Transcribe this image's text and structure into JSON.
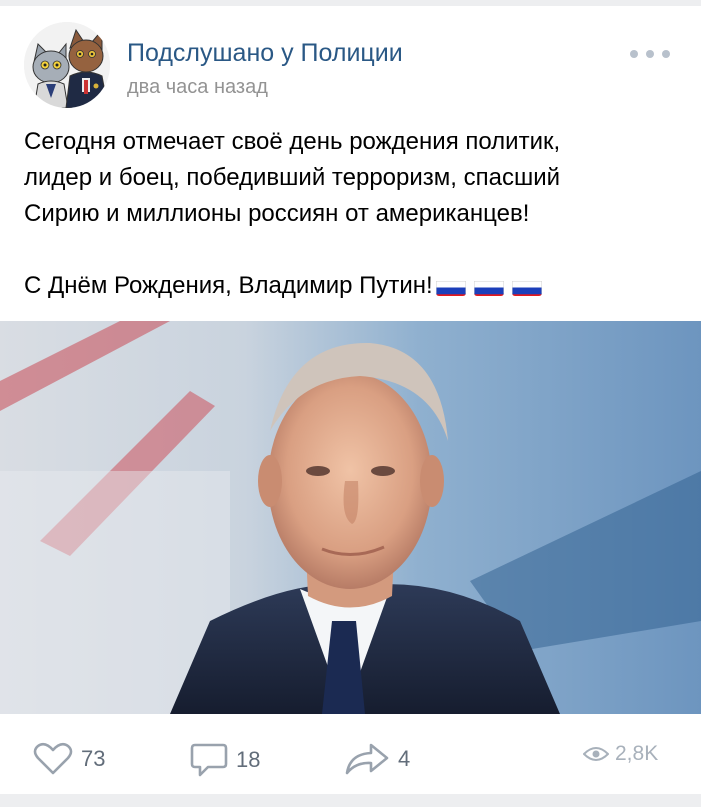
{
  "post": {
    "author": "Подслушано у Полиции",
    "time": "два часа назад",
    "text_lines": [
      "Сегодня отмечает своё день рождения политик,",
      "лидер и боец, победивший терроризм, спасший",
      "Сирию и миллионы россиян от американцев!"
    ],
    "greeting": "С Днём Рождения, Владимир Путин!",
    "flag_count": 3
  },
  "actions": {
    "likes": "73",
    "comments": "18",
    "shares": "4",
    "views": "2,8K"
  },
  "icons": {
    "like": "heart-icon",
    "comment": "comment-icon",
    "share": "share-arrow-icon",
    "views": "eye-icon",
    "more": "more-dots-icon"
  },
  "colors": {
    "author": "#2a5885",
    "meta": "#939393",
    "action": "#626d7a",
    "views": "#a8b1bb",
    "flag_white": "#ffffff",
    "flag_blue": "#1c3fba",
    "flag_red": "#e4181c"
  }
}
